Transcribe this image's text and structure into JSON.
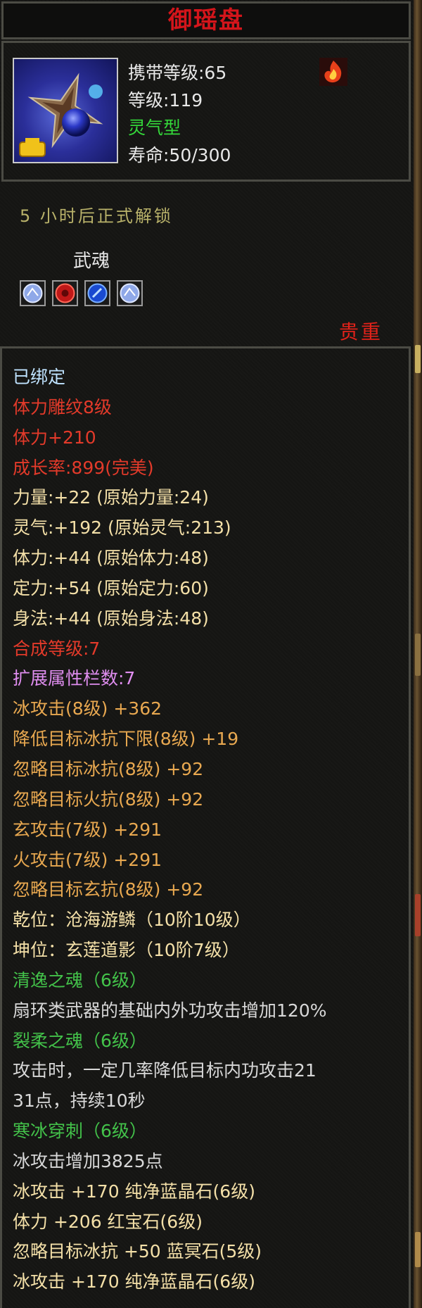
{
  "title": "御瑶盘",
  "header": {
    "carry_level": "携带等级:65",
    "level": "等级:119",
    "type": "灵气型",
    "lifespan": "寿命:50/300"
  },
  "unlock_text": "5 小时后正式解锁",
  "soul": {
    "label": "武魂",
    "slots": [
      "white-blue-orb-icon",
      "red-orb-icon",
      "blue-orb-icon",
      "white-blue-orb-icon"
    ]
  },
  "rarity": "贵重",
  "attributes": [
    {
      "text": "已绑定",
      "color": "cyan"
    },
    {
      "text": "体力雕纹8级",
      "color": "red"
    },
    {
      "text": "体力+210",
      "color": "red"
    },
    {
      "text": "成长率:899(完美)",
      "color": "red"
    },
    {
      "text": "力量:+22 (原始力量:24)",
      "color": "yellow"
    },
    {
      "text": "灵气:+192 (原始灵气:213)",
      "color": "yellow"
    },
    {
      "text": "体力:+44 (原始体力:48)",
      "color": "yellow"
    },
    {
      "text": "定力:+54 (原始定力:60)",
      "color": "yellow"
    },
    {
      "text": "身法:+44 (原始身法:48)",
      "color": "yellow"
    },
    {
      "text": "合成等级:7",
      "color": "red"
    },
    {
      "text": "扩展属性栏数:7",
      "color": "pink"
    },
    {
      "text": "冰攻击(8级) +362",
      "color": "orange"
    },
    {
      "text": "降低目标冰抗下限(8级) +19",
      "color": "orange"
    },
    {
      "text": "忽略目标冰抗(8级) +92",
      "color": "orange"
    },
    {
      "text": "忽略目标火抗(8级) +92",
      "color": "orange"
    },
    {
      "text": "玄攻击(7级) +291",
      "color": "orange"
    },
    {
      "text": "火攻击(7级) +291",
      "color": "orange"
    },
    {
      "text": "忽略目标玄抗(8级) +92",
      "color": "orange"
    },
    {
      "text": "乾位：沧海游鳞（10阶10级）",
      "color": "yellow"
    },
    {
      "text": "坤位：玄莲道影（10阶7级）",
      "color": "yellow"
    },
    {
      "text": "清逸之魂（6级）",
      "color": "green"
    },
    {
      "text": "扇环类武器的基础内外功攻击增加120%",
      "color": "white"
    },
    {
      "text": "裂柔之魂（6级）",
      "color": "green"
    },
    {
      "text": "攻击时，一定几率降低目标内功攻击21",
      "color": "white"
    },
    {
      "text": "31点，持续10秒",
      "color": "white"
    },
    {
      "text": "寒冰穿刺（6级）",
      "color": "green"
    },
    {
      "text": "冰攻击增加3825点",
      "color": "white"
    },
    {
      "text": "冰攻击 +170 纯净蓝晶石(6级)",
      "color": "yellow"
    },
    {
      "text": "体力 +206 红宝石(6级)",
      "color": "yellow"
    },
    {
      "text": "忽略目标冰抗 +50 蓝冥石(5级)",
      "color": "yellow"
    },
    {
      "text": "冰攻击 +170 纯净蓝晶石(6级)",
      "color": "yellow"
    }
  ]
}
